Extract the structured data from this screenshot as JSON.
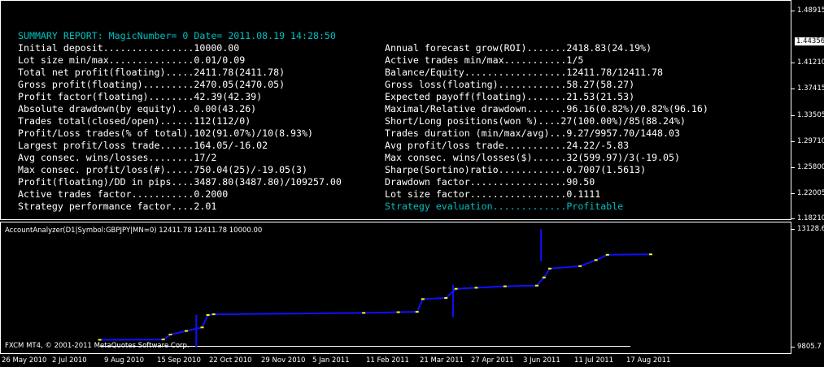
{
  "report": {
    "title": "SUMMARY REPORT: MagicNumber= 0 Date= 2011.08.19 14:28:50",
    "rows": [
      {
        "left": "Initial deposit................10000.00",
        "right": "Annual forecast grow(ROI).......2418.83(24.19%)"
      },
      {
        "left": "Lot size min/max...............0.01/0.09",
        "right": "Active trades min/max...........1/5"
      },
      {
        "left": "Total net profit(floating).....2411.78(2411.78)",
        "right": "Balance/Equity..................12411.78/12411.78"
      },
      {
        "left": "Gross profit(floating).........2470.05(2470.05)",
        "right": "Gross loss(floating)............58.27(58.27)"
      },
      {
        "left": "Profit factor(floating)........42.39(42.39)",
        "right": "Expected payoff(floating).......21.53(21.53)"
      },
      {
        "left": "Absolute drawdown(by equity)...0.00(43.26)",
        "right": "Maximal/Relative drawdown.......96.16(0.82%)/0.82%(96.16)"
      },
      {
        "left": "Trades total(closed/open)......112(112/0)",
        "right": "Short/Long positions(won %)....27(100.00%)/85(88.24%)"
      },
      {
        "left": "Profit/Loss trades(% of total).102(91.07%)/10(8.93%)",
        "right": "Trades duration (min/max/avg)...9.27/9957.70/1448.03"
      },
      {
        "left": "Largest profit/loss trade......164.05/-16.02",
        "right": "Avg profit/loss trade...........24.22/-5.83"
      },
      {
        "left": "Avg consec. wins/losses........17/2",
        "right": "Max consec. wins/losses($)......32(599.97)/3(-19.05)"
      },
      {
        "left": "Max consec. profit/loss(#).....750.04(25)/-19.05(3)",
        "right": "Sharpe(Sortino)ratio............0.7007(1.5613)"
      },
      {
        "left": "Profit(floating)/DD in pips....3487.80(3487.80)/109257.00",
        "right": "Drawdown factor.................90.50"
      },
      {
        "left": "Active trades factor...........0.2000",
        "right": "Lot size factor.................0.1111"
      },
      {
        "left": "Strategy performance factor....2.01",
        "right": "Strategy evaluation.............Profitable"
      }
    ]
  },
  "price_axis": {
    "labels": [
      "1.48915",
      "1.41210",
      "1.37415",
      "1.33505",
      "1.29710",
      "1.25800",
      "1.22005",
      "1.18210"
    ],
    "current": "1.44356"
  },
  "indicator": {
    "label": "AccountAnalyzer(D1|Symbol:GBPJPY|MN=0) 12411.78 12411.78 10000.00",
    "axis_max": "13128.6",
    "axis_min": "9805.7"
  },
  "copyright": "FXCM MT4, © 2001-2011 MetaQuotes Software Corp.",
  "time_axis": [
    "26 May 2010",
    "2 Jul 2010",
    "9 Aug 2010",
    "15 Sep 2010",
    "22 Oct 2010",
    "29 Nov 2010",
    "5 Jan 2011",
    "11 Feb 2011",
    "21 Mar 2011",
    "27 Apr 2011",
    "3 Jun 2011",
    "11 Jul 2011",
    "17 Aug 2011"
  ],
  "colors": {
    "background": "#000000",
    "report_title": "#00c0c0",
    "equity_line": "#1010ff",
    "balance_line": "#ffff00",
    "baseline": "#ffffff"
  },
  "chart_data": {
    "type": "line",
    "ylim": [
      9805.7,
      13128.6
    ],
    "x_range": [
      "2010-05-26",
      "2011-08-19"
    ],
    "series": [
      {
        "values": [
          {
            "x": "2010-08-02",
            "y": 10000
          },
          {
            "x": "2010-09-15",
            "y": 10010
          },
          {
            "x": "2010-09-20",
            "y": 10150
          },
          {
            "x": "2010-10-01",
            "y": 10250
          },
          {
            "x": "2010-10-12",
            "y": 10350
          },
          {
            "x": "2010-10-16",
            "y": 10700
          },
          {
            "x": "2010-10-20",
            "y": 10720
          },
          {
            "x": "2011-02-01",
            "y": 10760
          },
          {
            "x": "2011-02-25",
            "y": 10780
          },
          {
            "x": "2011-03-10",
            "y": 10790
          },
          {
            "x": "2011-03-14",
            "y": 11150
          },
          {
            "x": "2011-03-30",
            "y": 11180
          },
          {
            "x": "2011-04-06",
            "y": 11440
          },
          {
            "x": "2011-04-20",
            "y": 11470
          },
          {
            "x": "2011-05-10",
            "y": 11510
          },
          {
            "x": "2011-06-01",
            "y": 11530
          },
          {
            "x": "2011-06-06",
            "y": 11760
          },
          {
            "x": "2011-06-10",
            "y": 12010
          },
          {
            "x": "2011-07-01",
            "y": 12080
          },
          {
            "x": "2011-07-12",
            "y": 12250
          },
          {
            "x": "2011-07-20",
            "y": 12400
          },
          {
            "x": "2011-08-19",
            "y": 12411.78
          }
        ]
      }
    ],
    "equity_spikes": [
      {
        "x": "2010-10-08",
        "y": 10700
      },
      {
        "x": "2011-04-04",
        "y": 11550
      },
      {
        "x": "2011-06-04",
        "y": 13128.6
      }
    ]
  }
}
